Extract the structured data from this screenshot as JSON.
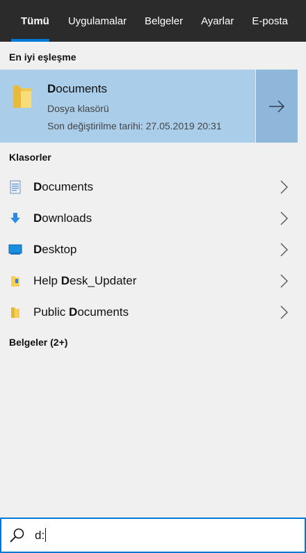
{
  "tabs": [
    "Tümü",
    "Uygulamalar",
    "Belgeler",
    "Ayarlar",
    "E-posta"
  ],
  "best_match": {
    "section": "En iyi eşleşme",
    "title_bold": "D",
    "title_rest": "ocuments",
    "type": "Dosya klasörü",
    "modified": "Son değiştirilme tarihi: 27.05.2019 20:31",
    "icon": "folder-icon"
  },
  "folders": {
    "section": "Klasorler",
    "items": [
      {
        "pre": "",
        "bold": "D",
        "post": "ocuments",
        "icon": "document-folder-icon"
      },
      {
        "pre": "",
        "bold": "D",
        "post": "ownloads",
        "icon": "download-arrow-icon"
      },
      {
        "pre": "",
        "bold": "D",
        "post": "esktop",
        "icon": "desktop-icon"
      },
      {
        "pre": "Help ",
        "bold": "D",
        "post": "esk_Updater",
        "icon": "folder-shortcut-icon"
      },
      {
        "pre": "Public ",
        "bold": "D",
        "post": "ocuments",
        "icon": "folder-icon"
      }
    ]
  },
  "documents_section": "Belgeler (2+)",
  "search": {
    "query": "d:"
  },
  "colors": {
    "accent": "#0078d7",
    "highlight": "#aacde9",
    "tabbar": "#2b2b2b"
  }
}
